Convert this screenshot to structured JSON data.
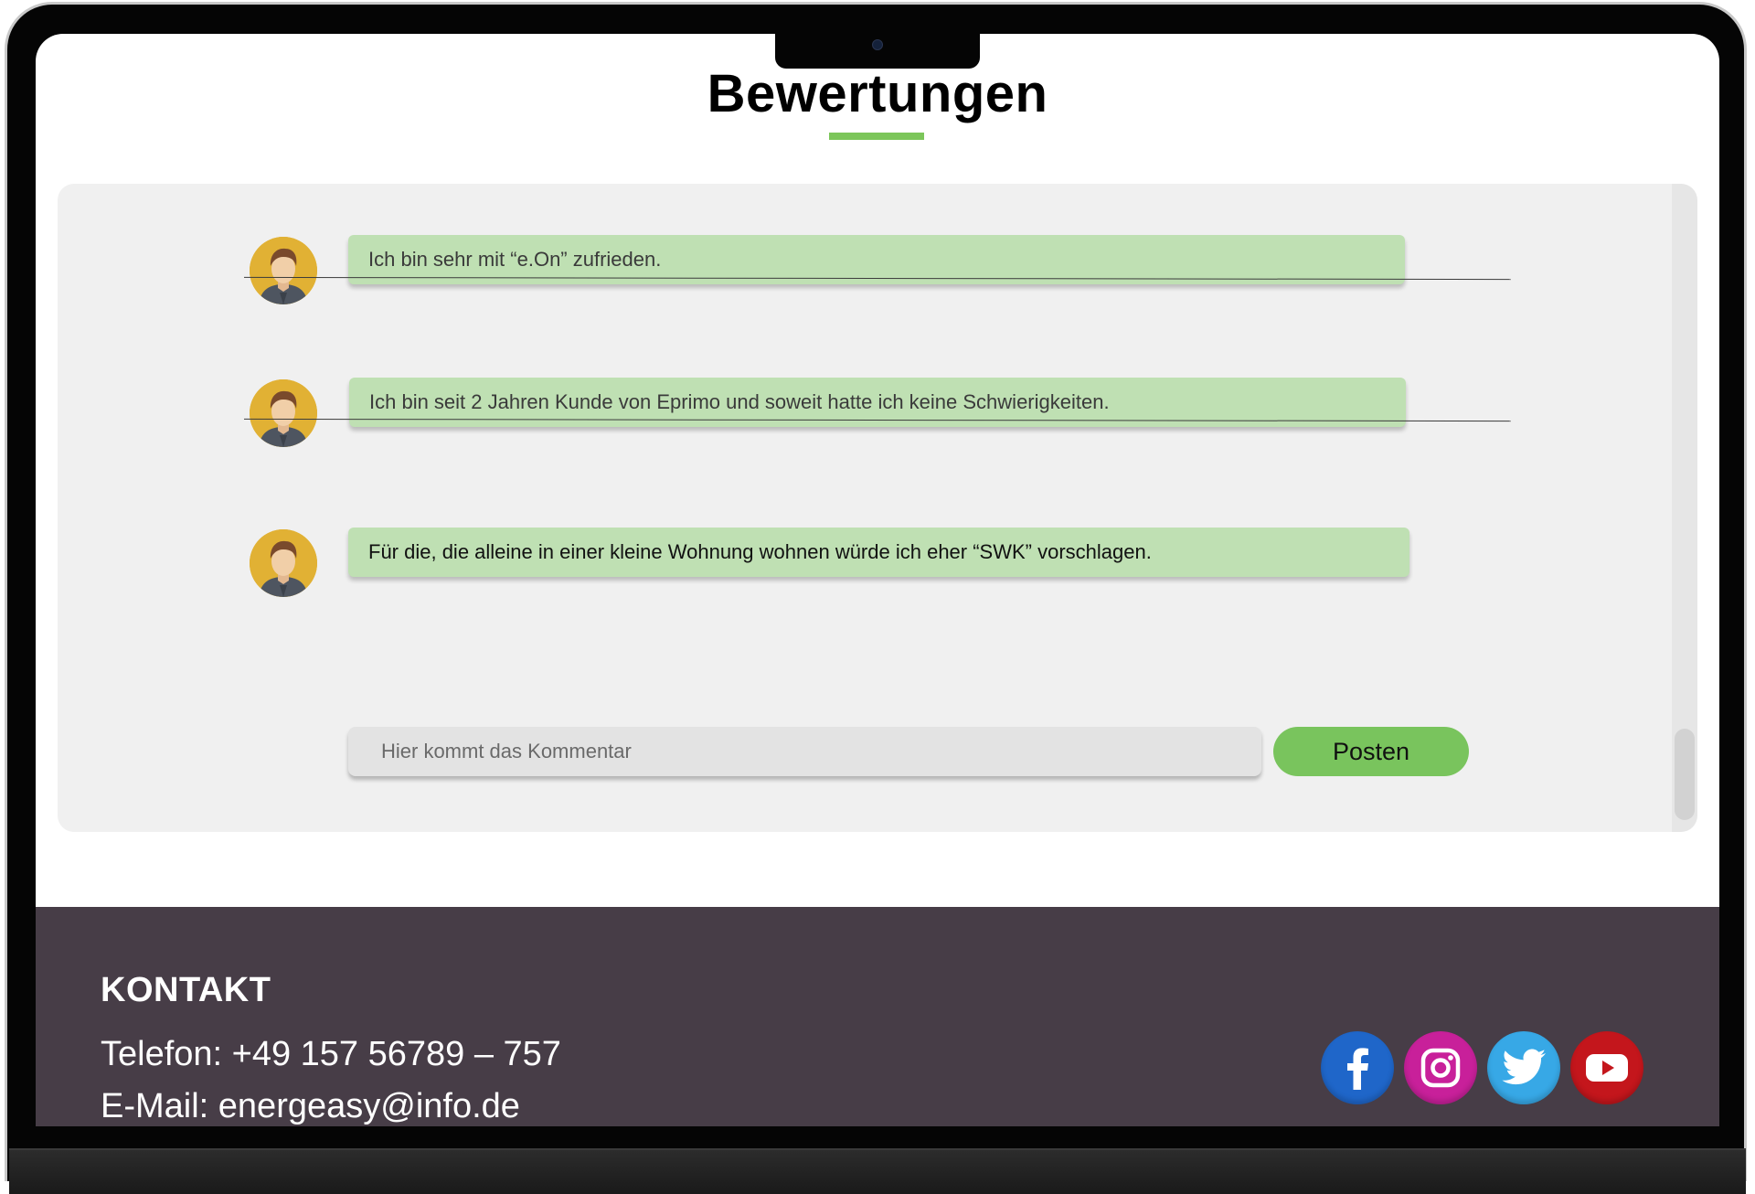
{
  "page": {
    "title": "Bewertungen"
  },
  "reviews": [
    {
      "text": "Ich bin sehr mit “e.On” zufrieden."
    },
    {
      "text": "Ich bin seit 2 Jahren Kunde von Eprimo und soweit hatte ich keine Schwierigkeiten."
    },
    {
      "text": "Für die, die alleine in einer kleine Wohnung wohnen würde ich eher “SWK” vorschlagen."
    }
  ],
  "comment_form": {
    "placeholder": "Hier kommt das Kommentar",
    "value": "",
    "post_label": "Posten"
  },
  "footer": {
    "title": "KONTAKT",
    "phone": "Telefon: +49 157 56789 – 757",
    "email": "E-Mail: energeasy@info.de"
  },
  "social_icons": [
    {
      "name": "facebook-icon",
      "color": "#1f66c9"
    },
    {
      "name": "instagram-icon",
      "color": "#c8209a"
    },
    {
      "name": "twitter-icon",
      "color": "#37a8e6"
    },
    {
      "name": "youtube-icon",
      "color": "#c4161c"
    }
  ],
  "colors": {
    "accent": "#7cc65a",
    "bubble": "#bfe0b3",
    "panel": "#f0f0f0",
    "footer": "#473d47"
  }
}
